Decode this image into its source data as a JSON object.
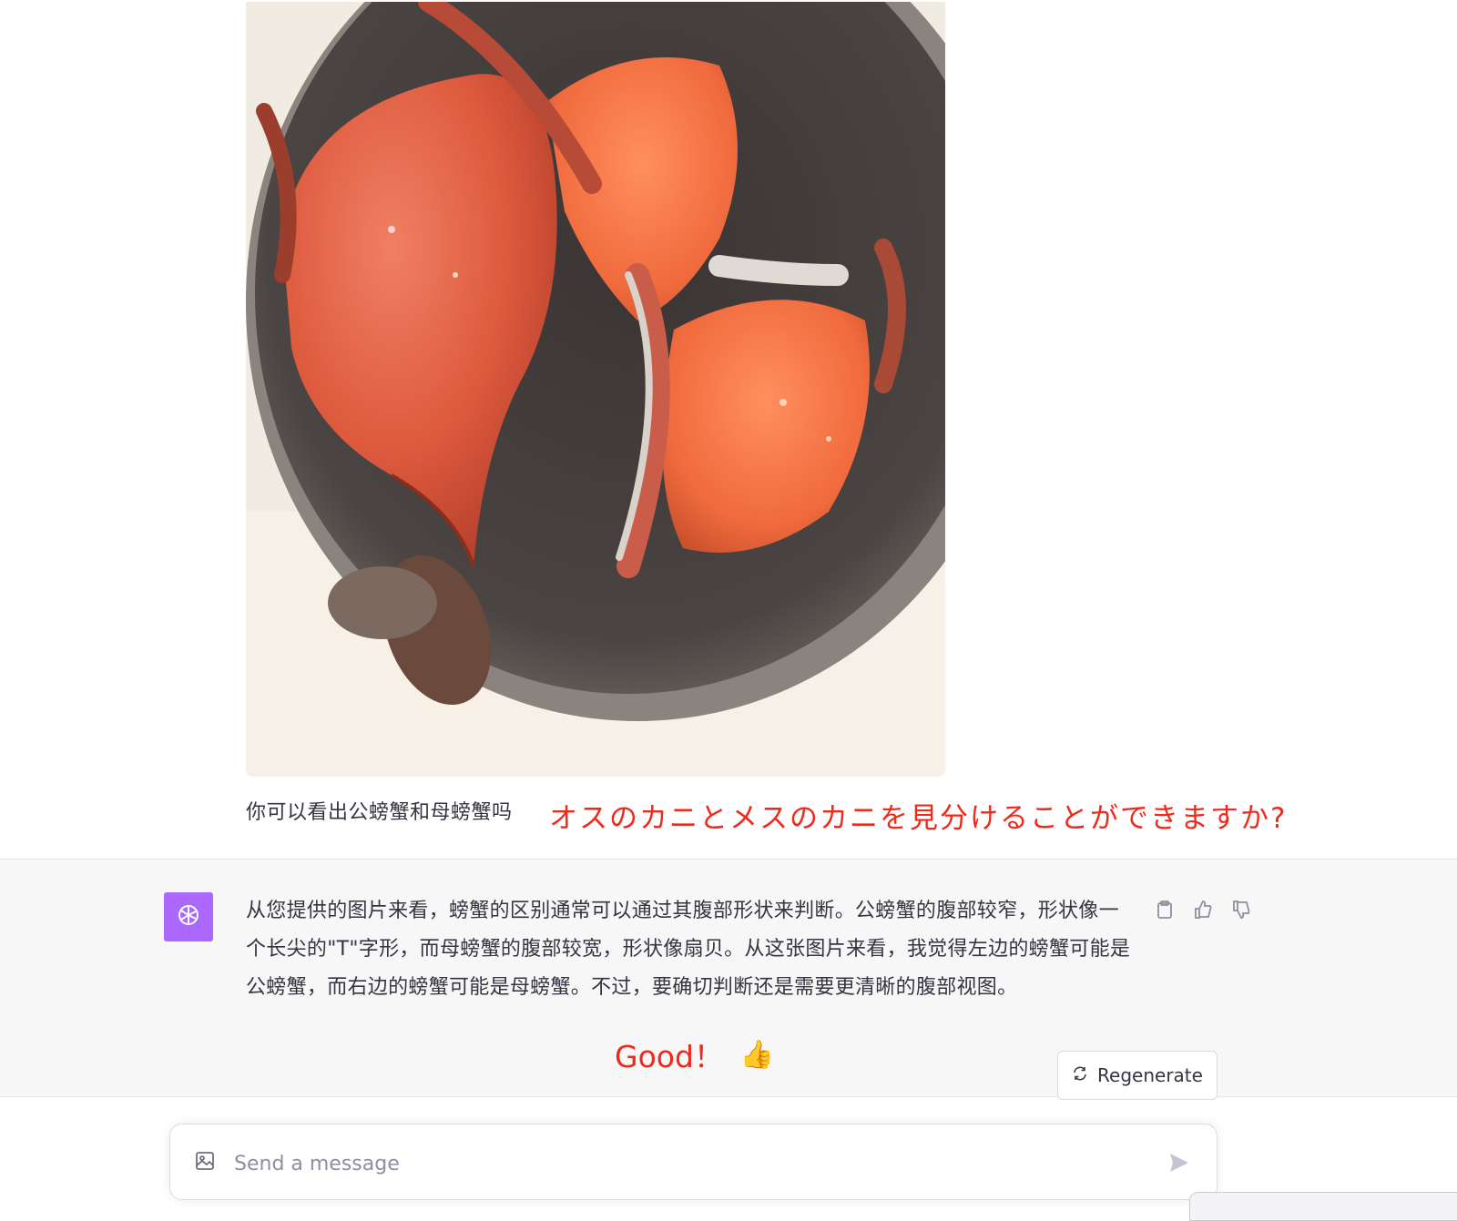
{
  "user_message": {
    "text": "你可以看出公螃蟹和母螃蟹吗",
    "annotation": "オスのカニとメスのカニを見分けることができますか?"
  },
  "assistant_message": {
    "text": "从您提供的图片来看，螃蟹的区别通常可以通过其腹部形状来判断。公螃蟹的腹部较窄，形状像一个长尖的\"T\"字形，而母螃蟹的腹部较宽，形状像扇贝。从这张图片来看，我觉得左边的螃蟹可能是公螃蟹，而右边的螃蟹可能是母螃蟹。不过，要确切判断还是需要更清晰的腹部视图。",
    "annotation": "Good！",
    "annotation_emoji": "👍"
  },
  "actions": {
    "regenerate_label": "Regenerate"
  },
  "composer": {
    "placeholder": "Send a message"
  },
  "colors": {
    "annotation_red": "#ef2a1c",
    "avatar_purple": "#ab68ff",
    "assistant_bg": "#f7f7f8"
  },
  "icons": [
    "clipboard-icon",
    "thumbs-up-icon",
    "thumbs-down-icon",
    "refresh-icon",
    "image-icon",
    "send-icon",
    "openai-logo-icon"
  ]
}
